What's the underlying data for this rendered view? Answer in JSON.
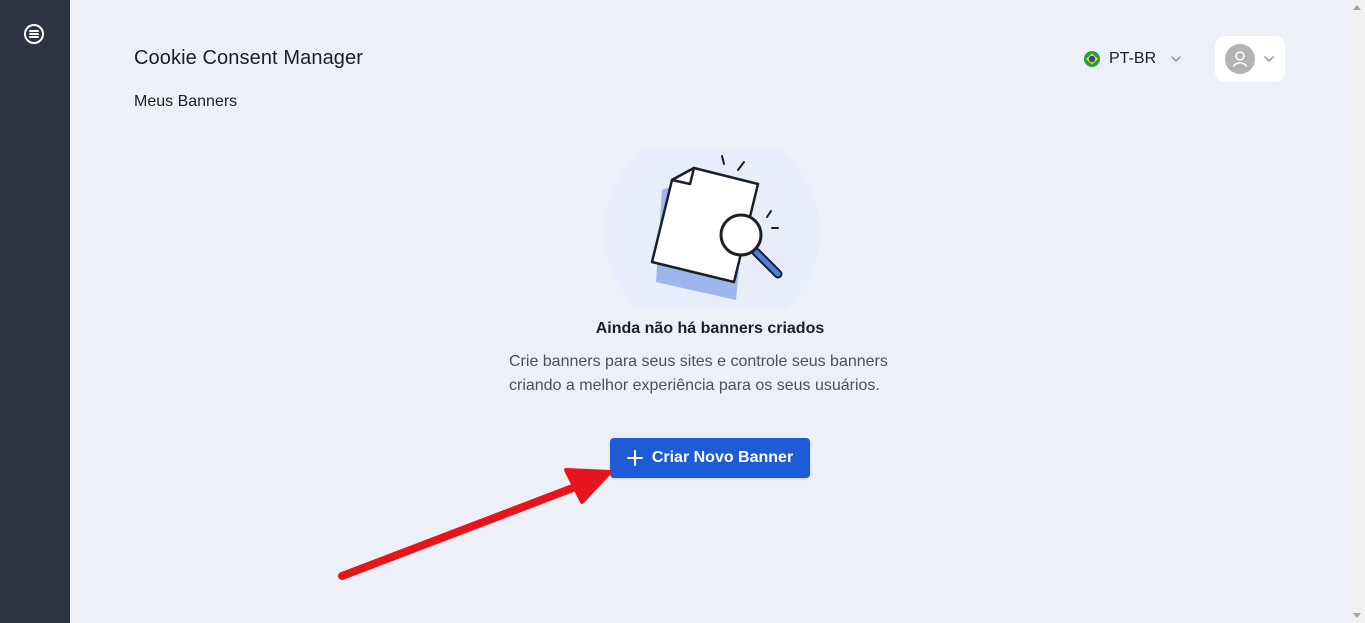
{
  "header": {
    "app_title": "Cookie Consent Manager",
    "breadcrumb": "Meus Banners",
    "language": {
      "selected": "PT-BR",
      "flag_icon": "brazil-flag-icon"
    },
    "user_menu": {
      "avatar_icon": "user-avatar-icon"
    }
  },
  "sidebar": {
    "menu_icon": "menu-icon"
  },
  "empty_state": {
    "illustration": "document-search-illustration",
    "title": "Ainda não há banners criados",
    "description": "Crie banners para seus sites e controle seus banners criando a melhor experiência para os seus usuários.",
    "button_label": "Criar Novo Banner"
  },
  "colors": {
    "sidebar": "#2d3446",
    "background": "#edf0f7",
    "primary": "#1e5bd6",
    "annotation_arrow": "#e8141b"
  }
}
